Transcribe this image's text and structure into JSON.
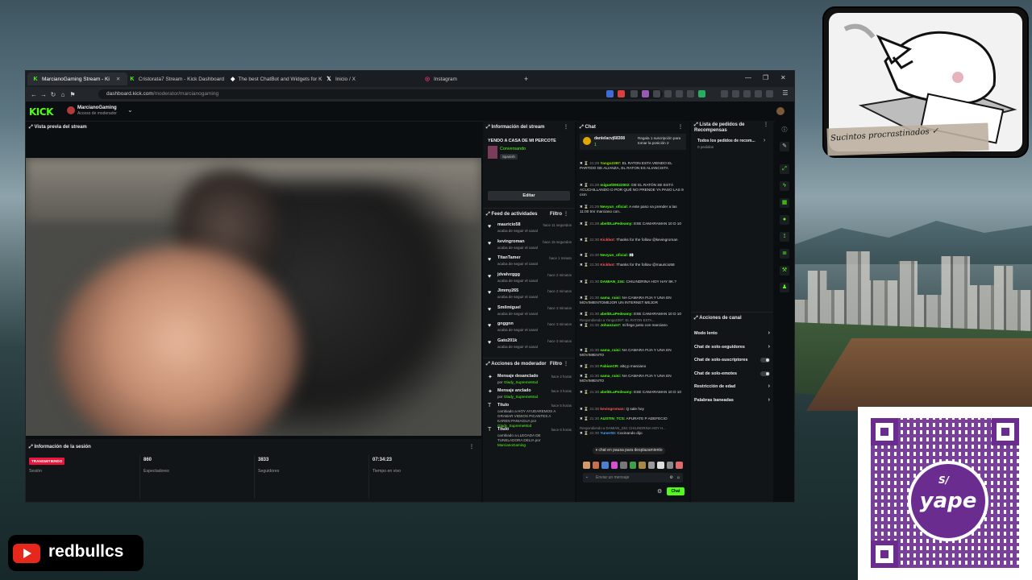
{
  "browser": {
    "tabs": [
      {
        "title": "MarcianoGaming Stream - Ki",
        "icon": "kick-icon",
        "active": true
      },
      {
        "title": "Cristorata7 Stream - Kick Dashboard",
        "icon": "kick-icon"
      },
      {
        "title": "The best ChatBot and Widgets for K",
        "icon": "botrix-icon"
      },
      {
        "title": "Inicio / X",
        "icon": "x-icon"
      },
      {
        "title": "Instagram",
        "icon": "instagram-icon"
      }
    ],
    "new_tab": "+",
    "url_host": "dashboard.kick.com",
    "url_path": "/moderator/marcianogaming"
  },
  "header": {
    "logo": "KICK",
    "channel_name": "MarcianoGaming",
    "role": "Acceso de moderador"
  },
  "preview": {
    "title": "Vista previa del stream"
  },
  "session": {
    "title": "Información de la sesión",
    "status": "TRANSMITIENDO",
    "status_label": "Sesión",
    "viewers": "860",
    "viewers_label": "Espectadores",
    "followers": "3833",
    "followers_label": "Seguidores",
    "live_time": "07:34:23",
    "live_time_label": "Tiempo en vivo"
  },
  "stream_info": {
    "title": "Información del stream",
    "stream_title": "YENDO A CASA DE MI PERCOTE",
    "category": "Conversando",
    "language": "Spanish",
    "edit_label": "Editar"
  },
  "activity": {
    "title": "Feed de actividades",
    "filter": "Filtro",
    "items": [
      {
        "name": "mauricio58",
        "sub": "acaba de seguir el canal",
        "time": "hace 11 segundos"
      },
      {
        "name": "kevingroman",
        "sub": "acaba de seguir el canal",
        "time": "hace 15 segundos"
      },
      {
        "name": "TitanTamer",
        "sub": "acaba de seguir el canal",
        "time": "hace 1 minuto"
      },
      {
        "name": "jdvalvzggg",
        "sub": "acaba de seguir el canal",
        "time": "hace 2 minutos"
      },
      {
        "name": "Jimmy265",
        "sub": "acaba de seguir el canal",
        "time": "hace 2 minutos"
      },
      {
        "name": "Smilmiguel",
        "sub": "acaba de seguir el canal",
        "time": "hace 3 minutos"
      },
      {
        "name": "gnggnn",
        "sub": "acaba de seguir el canal",
        "time": "hace 3 minutos"
      },
      {
        "name": "Gato201k",
        "sub": "acaba de seguir el canal",
        "time": "hace 3 minutos"
      }
    ]
  },
  "mod_actions": {
    "title": "Acciones de moderador",
    "filter": "Filtro",
    "items": [
      {
        "name": "Mensaje desanclado",
        "sub_pre": "por",
        "user": "Glady_SupremeMod",
        "time": "hace 2 horas"
      },
      {
        "name": "Mensaje anclado",
        "sub_pre": "por",
        "user": "Glady_SupremeMod",
        "time": "hace 3 horas"
      },
      {
        "name": "Título",
        "sub_pre": "cambiado a HOY AYUDAREMOS A GRABAR VIDEOS PICANTES A KAREN PANIAGUA por",
        "user": "Glady_SupremeMod",
        "time": "hace 5 horas"
      },
      {
        "name": "Título",
        "sub_pre": "cambiado a LLEGADA DE TUNELADORA DELIA por",
        "user": "MarcianoGaming",
        "time": "hace 6 horas"
      }
    ]
  },
  "chat": {
    "title": "Chat",
    "pinned_user": "danielacvj68308",
    "pinned_count": "1",
    "pinned_msg": "Regala 1 suscripción para tomar la posición 2",
    "messages": [
      {
        "time": "21:29",
        "user": "Yango2397:",
        "color": "#8ee000",
        "text": "EL RATON ESTA VIENDO EL PARTIDO DE ALIANZA, EL RATON ES ALIANCISTA"
      },
      {
        "time": "21:29",
        "user": "miguel09022002:",
        "color": "#53fc18",
        "text": "DE EL RATÓN SE ESTÁ ACUCHILLANDO O POR QUÉ NO PRENDE YA PASO LAS 9 csm"
      },
      {
        "time": "21:29",
        "user": "Nevyun_oficial:",
        "color": "#53fc18",
        "text": "A este paso va prender a las 11:00 tmr marciano con.."
      },
      {
        "time": "21:29",
        "user": "abelDLaPedeamy:",
        "color": "#53fc18",
        "text": "ESE CAMARAMAN 10 D 10"
      },
      {
        "time": "21:30",
        "user": "Kickbot:",
        "color": "#ff5a5a",
        "text": "Thanks for the follow @kevingroman"
      },
      {
        "time": "21:30",
        "user": "Nevyun_oficial:",
        "color": "#53fc18",
        "text": "👀"
      },
      {
        "time": "21:30",
        "user": "Kickbot:",
        "color": "#ff5a5a",
        "text": "Thanks for the follow @mauricio58"
      },
      {
        "time": "21:30",
        "user": "DAMIAN_234:",
        "color": "#53fc18",
        "text": "CHILINDRINA HOY HAY 8K.?"
      },
      {
        "time": "21:30",
        "user": "sama_raisi:",
        "color": "#53fc18",
        "text": "NA CAMARA FIJA Y UNA EN MOVIMIENTOMEJOR UN INTERNET MEJOR"
      },
      {
        "time": "21:30",
        "user": "abelDLaPedeamy:",
        "color": "#53fc18",
        "text": "ESE CAMARAMAN 10 D 10"
      },
      {
        "time": "21:30",
        "user": "Johanzun7:",
        "color": "#53fc18",
        "text": "Si llego justo con marciano",
        "reply": "Respondiendo a Yango2397: EL RATON ESTA..."
      },
      {
        "time": "21:30",
        "user": "sama_raisi:",
        "color": "#53fc18",
        "text": "NA CAMARA FIJA Y UNA EN MOVIMIENTO"
      },
      {
        "time": "21:30",
        "user": "FabianCR:",
        "color": "#53fc18",
        "text": "altq p marciano"
      },
      {
        "time": "21:30",
        "user": "sama_raisi:",
        "color": "#53fc18",
        "text": "NA CAMARA FIJA Y UNA EN MOVIMIENTO"
      },
      {
        "time": "21:30",
        "user": "abelDLaPedeamy:",
        "color": "#53fc18",
        "text": "ESE CAMARAMAN 10 D 10"
      },
      {
        "time": "21:30",
        "user": "kevingroman:",
        "color": "#ff5a5a",
        "text": "Q sale hoy"
      },
      {
        "time": "21:30",
        "user": "AUSTIN_TCS:",
        "color": "#53fc18",
        "text": "APURATE P ADEFECIO"
      },
      {
        "time": "21:30",
        "user": "Yuner03:",
        "color": "#4aa8ff",
        "text": "Cocinando dijo",
        "reply": "Respondiendo a DAMIAN_234: CHILINDRINA HOY H..."
      }
    ],
    "paused_label": "chat en pausa para desplazamiento",
    "input_placeholder": "Enviar un mensaje",
    "send_label": "Chat"
  },
  "rewards": {
    "title": "Lista de pedidos de Recompensas",
    "all": "Todos los pedidos de recom...",
    "count": "0 pedidos"
  },
  "channel_actions": {
    "title": "Acciones de canal",
    "items": [
      {
        "label": "Modo lento",
        "kind": "chevron"
      },
      {
        "label": "Chat de solo-seguidores",
        "kind": "chevron"
      },
      {
        "label": "Chat de solo-suscriptores",
        "kind": "toggle"
      },
      {
        "label": "Chat de solo-emotes",
        "kind": "toggle"
      },
      {
        "label": "Restricción de edad",
        "kind": "chevron"
      },
      {
        "label": "Palabras baneadas",
        "kind": "chevron"
      }
    ]
  },
  "overlay": {
    "sign_text": "Sucintos procrastinados ✓",
    "yape_label": "yape",
    "yape_symbol": "S/",
    "social_handle": "redbullcs"
  },
  "colors": {
    "kick_green": "#53fc18",
    "live_red": "#e8163c",
    "yape_purple": "#6b2c90"
  }
}
